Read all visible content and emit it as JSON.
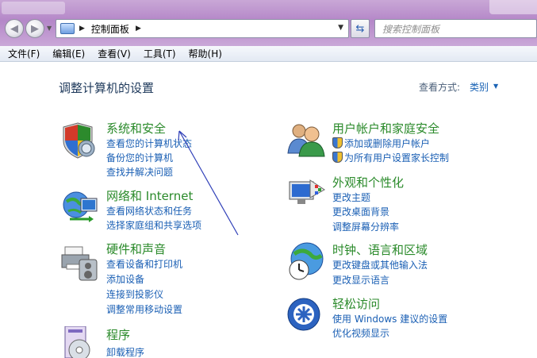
{
  "nav": {
    "address_crumb": "控制面板",
    "search_placeholder": "搜索控制面板"
  },
  "menu": [
    "文件(F)",
    "编辑(E)",
    "查看(V)",
    "工具(T)",
    "帮助(H)"
  ],
  "main": {
    "title": "调整计算机的设置",
    "view_by_label": "查看方式:",
    "view_by_value": "类别"
  },
  "categories": {
    "system": {
      "heading": "系统和安全",
      "links": [
        "查看您的计算机状态",
        "备份您的计算机",
        "查找并解决问题"
      ]
    },
    "network": {
      "heading": "网络和 Internet",
      "links": [
        "查看网络状态和任务",
        "选择家庭组和共享选项"
      ]
    },
    "hardware": {
      "heading": "硬件和声音",
      "links": [
        "查看设备和打印机",
        "添加设备",
        "连接到投影仪",
        "调整常用移动设置"
      ]
    },
    "programs": {
      "heading": "程序",
      "links": [
        "卸载程序"
      ]
    },
    "users": {
      "heading": "用户帐户和家庭安全",
      "links": [
        "添加或删除用户帐户",
        "为所有用户设置家长控制"
      ]
    },
    "appearance": {
      "heading": "外观和个性化",
      "links": [
        "更改主题",
        "更改桌面背景",
        "调整屏幕分辨率"
      ]
    },
    "clock": {
      "heading": "时钟、语言和区域",
      "links": [
        "更改键盘或其他输入法",
        "更改显示语言"
      ]
    },
    "ease": {
      "heading": "轻松访问",
      "links": [
        "使用 Windows 建议的设置",
        "优化视频显示"
      ]
    }
  },
  "colors": {
    "heading_green": "#2a8a2a",
    "link_blue": "#1a5fb4",
    "title_navy": "#1e395b",
    "annotation_arrow": "#2f3fb8"
  }
}
